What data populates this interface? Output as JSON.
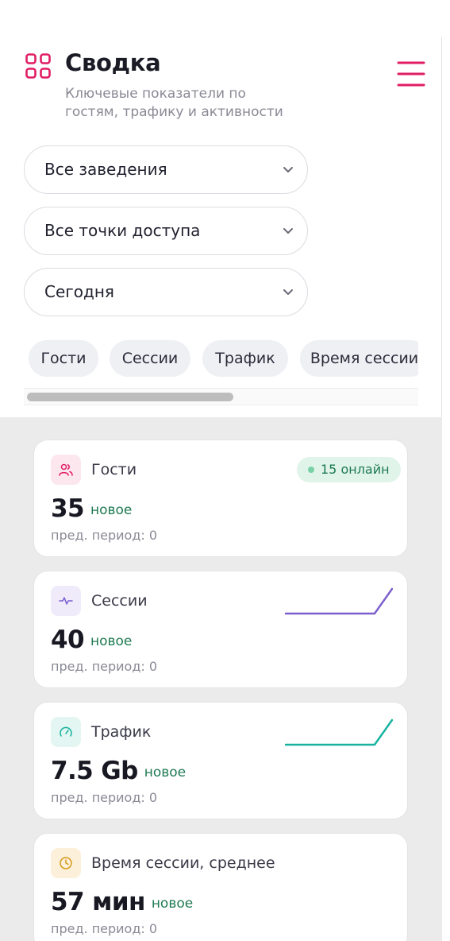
{
  "header": {
    "title": "Сводка",
    "subtitle": "Ключевые показатели по гостям, трафику и активности",
    "title_icon": "dashboard-grid-icon",
    "menu_icon": "hamburger-menu-icon"
  },
  "filters": {
    "venues": {
      "value": "Все заведения"
    },
    "access_points": {
      "value": "Все точки доступа"
    },
    "period": {
      "value": "Сегодня"
    }
  },
  "tabs": [
    {
      "label": "Гости"
    },
    {
      "label": "Сессии"
    },
    {
      "label": "Трафик"
    },
    {
      "label": "Время сессии"
    }
  ],
  "cards": {
    "guests": {
      "title": "Гости",
      "value": "35",
      "new_label": "новое",
      "prev": "пред. период: 0",
      "badge": "15 онлайн",
      "icon": "users-icon",
      "color": "#e11d63"
    },
    "sessions": {
      "title": "Сессии",
      "value": "40",
      "new_label": "новое",
      "prev": "пред. период: 0",
      "icon": "activity-pulse-icon",
      "color": "#7c5fce"
    },
    "traffic": {
      "title": "Трафик",
      "value": "7.5 Gb",
      "new_label": "новое",
      "prev": "пред. период: 0",
      "icon": "speedometer-icon",
      "color": "#17b3a0"
    },
    "duration": {
      "title": "Время сессии, среднее",
      "value": "57 мин",
      "new_label": "новое",
      "prev": "пред. период: 0",
      "icon": "clock-icon",
      "color": "#d49a1c"
    }
  },
  "colors": {
    "accent": "#e11d63",
    "positive": "#1e7a52",
    "sessions_line": "#7c5fce",
    "traffic_line": "#17b3a0"
  }
}
